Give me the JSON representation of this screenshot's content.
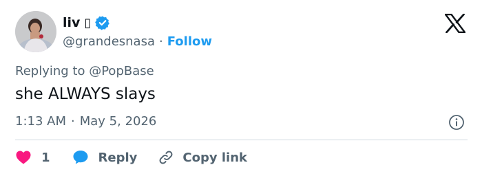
{
  "tweet": {
    "author": {
      "display_name": "liv",
      "name_emoji": "▯",
      "handle": "@grandesnasa",
      "follow_label": "Follow",
      "verified": true
    },
    "separator": "·",
    "replying_prefix": "Replying to",
    "replying_to": "@PopBase",
    "text": "she ALWAYS slays",
    "time": "1:13 AM",
    "date": "May 5, 2026",
    "actions": {
      "like_count": "1",
      "reply_label": "Reply",
      "copy_link_label": "Copy link"
    }
  },
  "icons": {
    "platform_logo": "x-logo-icon",
    "verified": "verified-badge-icon",
    "info": "info-icon",
    "like": "heart-icon",
    "reply": "speech-bubble-icon",
    "copy": "link-icon"
  },
  "colors": {
    "accent": "#1d9bf0",
    "heart": "#f91880",
    "text_primary": "#0f1419",
    "text_secondary": "#536471",
    "divider": "#cfd9de"
  }
}
